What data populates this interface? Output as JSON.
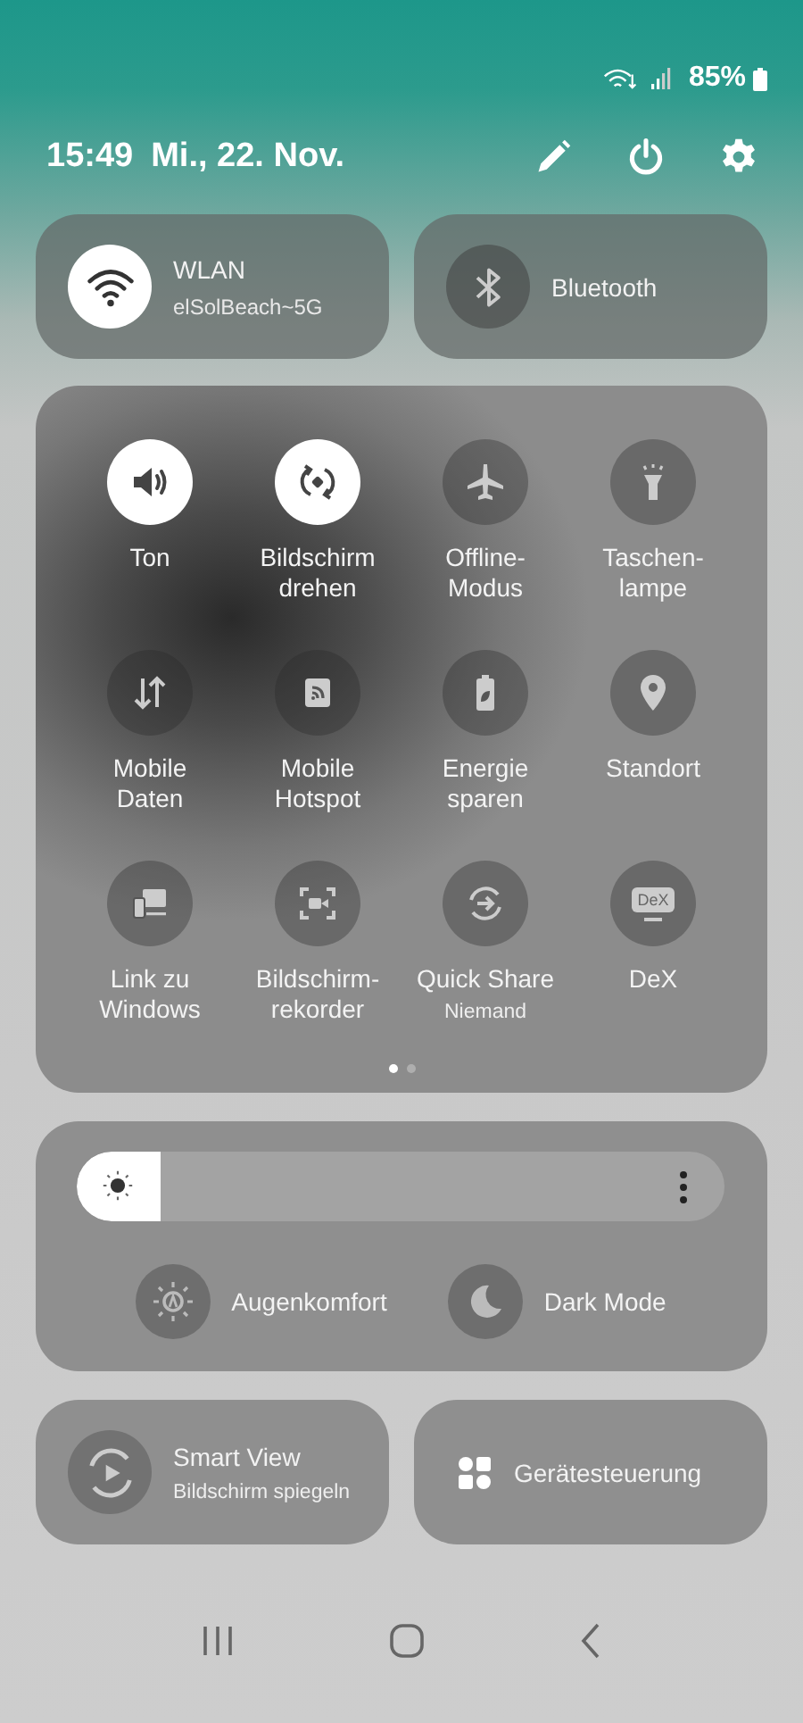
{
  "status_bar": {
    "battery": "85%"
  },
  "header": {
    "time": "15:49",
    "date": "Mi., 22. Nov."
  },
  "big_tiles": [
    {
      "kind": "wifi",
      "title": "WLAN",
      "subtitle": "elSolBeach~5G",
      "on": true
    },
    {
      "kind": "bluetooth",
      "title": "Bluetooth",
      "on": false
    }
  ],
  "toggles": [
    {
      "kind": "sound",
      "label": "Ton",
      "on": true
    },
    {
      "kind": "rotate",
      "label": "Bildschirm\ndrehen",
      "on": true
    },
    {
      "kind": "airplane",
      "label": "Offline-\nModus",
      "on": false
    },
    {
      "kind": "flashlight",
      "label": "Taschen-\nlampe",
      "on": false
    },
    {
      "kind": "data",
      "label": "Mobile\nDaten",
      "on": false
    },
    {
      "kind": "hotspot",
      "label": "Mobile\nHotspot",
      "on": false
    },
    {
      "kind": "battery",
      "label": "Energie\nsparen",
      "on": false
    },
    {
      "kind": "location",
      "label": "Standort",
      "on": false
    },
    {
      "kind": "link",
      "label": "Link zu\nWindows",
      "on": false
    },
    {
      "kind": "recorder",
      "label": "Bildschirm-\nrekorder",
      "on": false
    },
    {
      "kind": "share",
      "label": "Quick Share",
      "sublabel": "Niemand",
      "on": false
    },
    {
      "kind": "dex",
      "label": "DeX",
      "icon_text": "DeX",
      "on": false
    }
  ],
  "page_dots": [
    {
      "selected": true
    },
    {
      "selected": false
    }
  ],
  "brightness": {
    "level": 0.13
  },
  "display_toggles": [
    {
      "kind": "eye",
      "label": "Augenkomfort",
      "on": false
    },
    {
      "kind": "moon",
      "label": "Dark Mode",
      "on": false
    }
  ],
  "bottom_tiles": [
    {
      "kind": "smartview",
      "title": "Smart View",
      "subtitle": "Bildschirm spiegeln"
    },
    {
      "kind": "devices",
      "title": "Gerätesteuerung"
    }
  ]
}
